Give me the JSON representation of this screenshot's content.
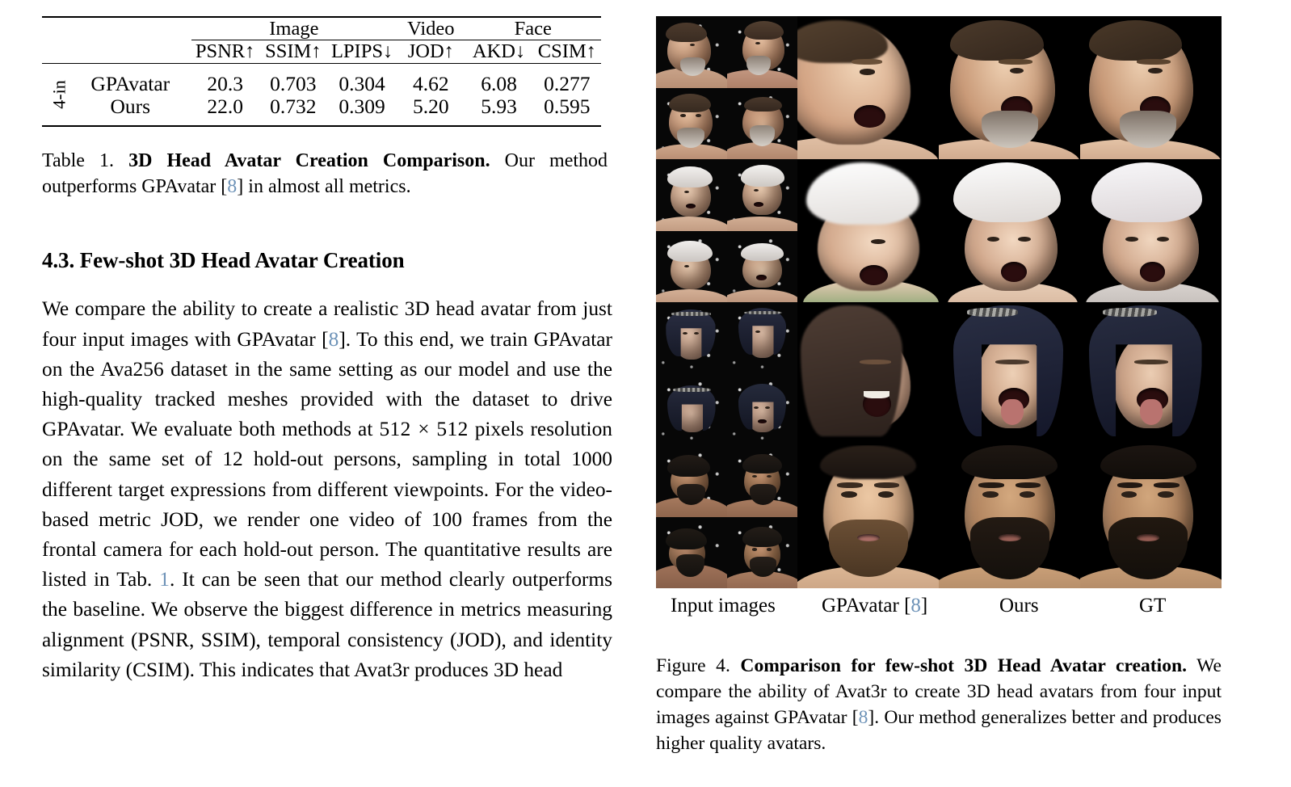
{
  "table": {
    "group_headers": [
      {
        "label": "Image",
        "span": 3
      },
      {
        "label": "Video",
        "span": 1
      },
      {
        "label": "Face",
        "span": 2
      }
    ],
    "column_headers": [
      "PSNR↑",
      "SSIM↑",
      "LPIPS↓",
      "JOD↑",
      "AKD↓",
      "CSIM↑"
    ],
    "row_group_label": "4-in",
    "rows": [
      {
        "method": "GPAvatar",
        "method_bold": false,
        "values": [
          "20.3",
          "0.703",
          "0.304",
          "4.62",
          "6.08",
          "0.277"
        ],
        "bold": [
          false,
          false,
          true,
          false,
          false,
          false
        ]
      },
      {
        "method": "Ours",
        "method_bold": false,
        "values": [
          "22.0",
          "0.732",
          "0.309",
          "5.20",
          "5.93",
          "0.595"
        ],
        "bold": [
          true,
          true,
          false,
          true,
          true,
          true
        ]
      }
    ]
  },
  "table_caption": {
    "prefix": "Table 1.",
    "bold_title": "3D Head Avatar Creation Comparison.",
    "rest_a": "Our method outperforms GPAvatar [",
    "citation": "8",
    "rest_b": "] in almost all metrics."
  },
  "section": {
    "heading": "4.3. Few-shot 3D Head Avatar Creation"
  },
  "body": {
    "p1_a": "We compare the ability to create a realistic 3D head avatar from just four input images with GPAvatar [",
    "cite1": "8",
    "p1_b": "]. To this end, we train GPAvatar on the Ava256 dataset in the same setting as our model and use the high-quality tracked meshes provided with the dataset to drive GPAvatar. We evaluate both methods at ",
    "resolution": "512 × 512",
    "p1_c": " pixels resolution on the same set of 12 hold-out persons, sampling in total 1000 different target expressions from different viewpoints. For the video-based metric JOD, we render one video of 100 frames from the frontal camera for each hold-out person. The quantitative results are listed in Tab. ",
    "cite2": "1",
    "p1_d": ". It can be seen that our method clearly outperforms the baseline. We observe the biggest difference in metrics measuring alignment (PSNR, SSIM), temporal consistency (JOD), and identity similarity (CSIM). This indicates that Avat3r produces 3D head"
  },
  "figure": {
    "column_labels": [
      {
        "text": "Input images",
        "left_pct": 5
      },
      {
        "text": "GPAvatar [8]",
        "left_pct": 29,
        "has_citation": true,
        "citation": "8"
      },
      {
        "text": "Ours",
        "left_pct": 60
      },
      {
        "text": "GT",
        "left_pct": 85
      }
    ],
    "column_label_plain": [
      "Input images",
      "GPAvatar",
      "Ours",
      "GT"
    ],
    "rows": [
      {
        "subject": "man-gray-beard",
        "expression": "mouth-open-yawn"
      },
      {
        "subject": "woman-white-hair",
        "expression": "mouth-open-shout"
      },
      {
        "subject": "woman-dark-blue-hair",
        "expression": "tongue-out"
      },
      {
        "subject": "man-black-beard",
        "expression": "neutral-frontal"
      }
    ],
    "caption": {
      "prefix": "Figure 4.",
      "bold_title": "Comparison for few-shot 3D Head Avatar creation.",
      "rest_a": "We compare the ability of Avat3r to create 3D head avatars from four input images against GPAvatar [",
      "citation": "8",
      "rest_b": "]. Our method generalizes better and produces higher quality avatars."
    }
  },
  "colors": {
    "citation_link": "#6E93B8",
    "text": "#000000",
    "page_background": "#FFFFFF",
    "figure_background": "#000000"
  }
}
